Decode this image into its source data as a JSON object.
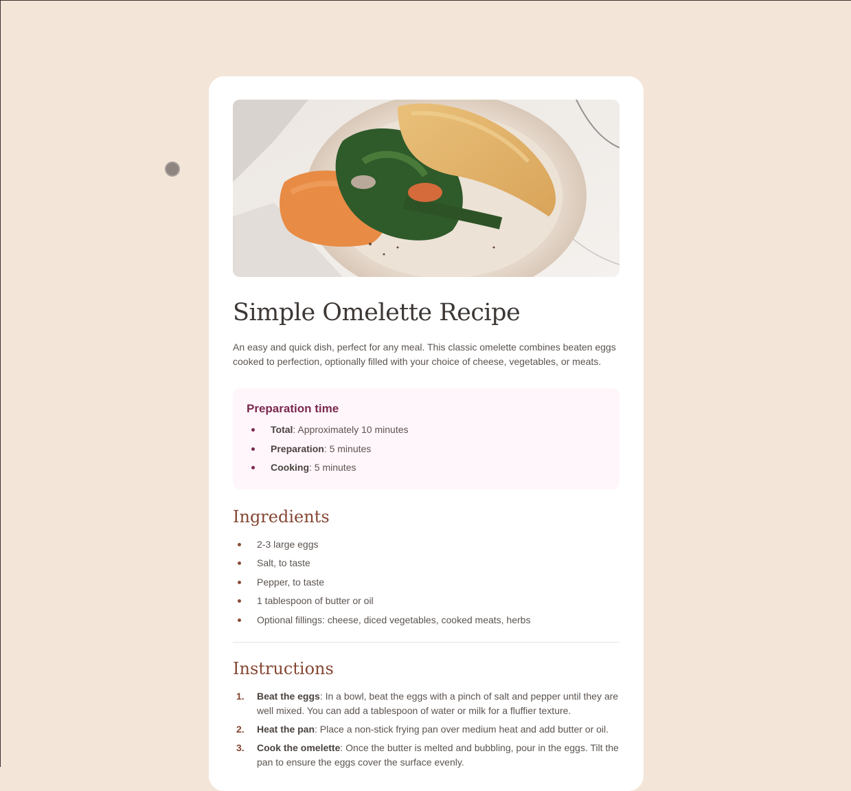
{
  "recipe": {
    "title": "Simple Omelette Recipe",
    "description": "An easy and quick dish, perfect for any meal. This classic omelette combines beaten eggs cooked to perfection, optionally filled with your choice of cheese, vegetables, or meats."
  },
  "preparation": {
    "heading": "Preparation time",
    "items": [
      {
        "label": "Total",
        "value": ": Approximately 10 minutes"
      },
      {
        "label": "Preparation",
        "value": ": 5 minutes"
      },
      {
        "label": "Cooking",
        "value": ": 5 minutes"
      }
    ]
  },
  "ingredients": {
    "heading": "Ingredients",
    "items": [
      "2-3 large eggs",
      "Salt, to taste",
      "Pepper, to taste",
      "1 tablespoon of butter or oil",
      "Optional fillings: cheese, diced vegetables, cooked meats, herbs"
    ]
  },
  "instructions": {
    "heading": "Instructions",
    "items": [
      {
        "number": "1.",
        "label": "Beat the eggs",
        "text": ": In a bowl, beat the eggs with a pinch of salt and pepper until they are well mixed. You can add a tablespoon of water or milk for a fluffier texture."
      },
      {
        "number": "2.",
        "label": "Heat the pan",
        "text": ": Place a non-stick frying pan over medium heat and add butter or oil."
      },
      {
        "number": "3.",
        "label": "Cook the omelette",
        "text": ": Once the butter is melted and bubbling, pour in the eggs. Tilt the pan to ensure the eggs cover the surface evenly."
      }
    ]
  },
  "colors": {
    "page_background": "#f4e5d9",
    "card_background": "#ffffff",
    "heading_brown": "#854632",
    "prep_accent": "#7a2850",
    "prep_background": "#fff6fb"
  },
  "icons": {
    "cursor": "cursor-dot-icon",
    "hero_image": "omelette-photo"
  }
}
